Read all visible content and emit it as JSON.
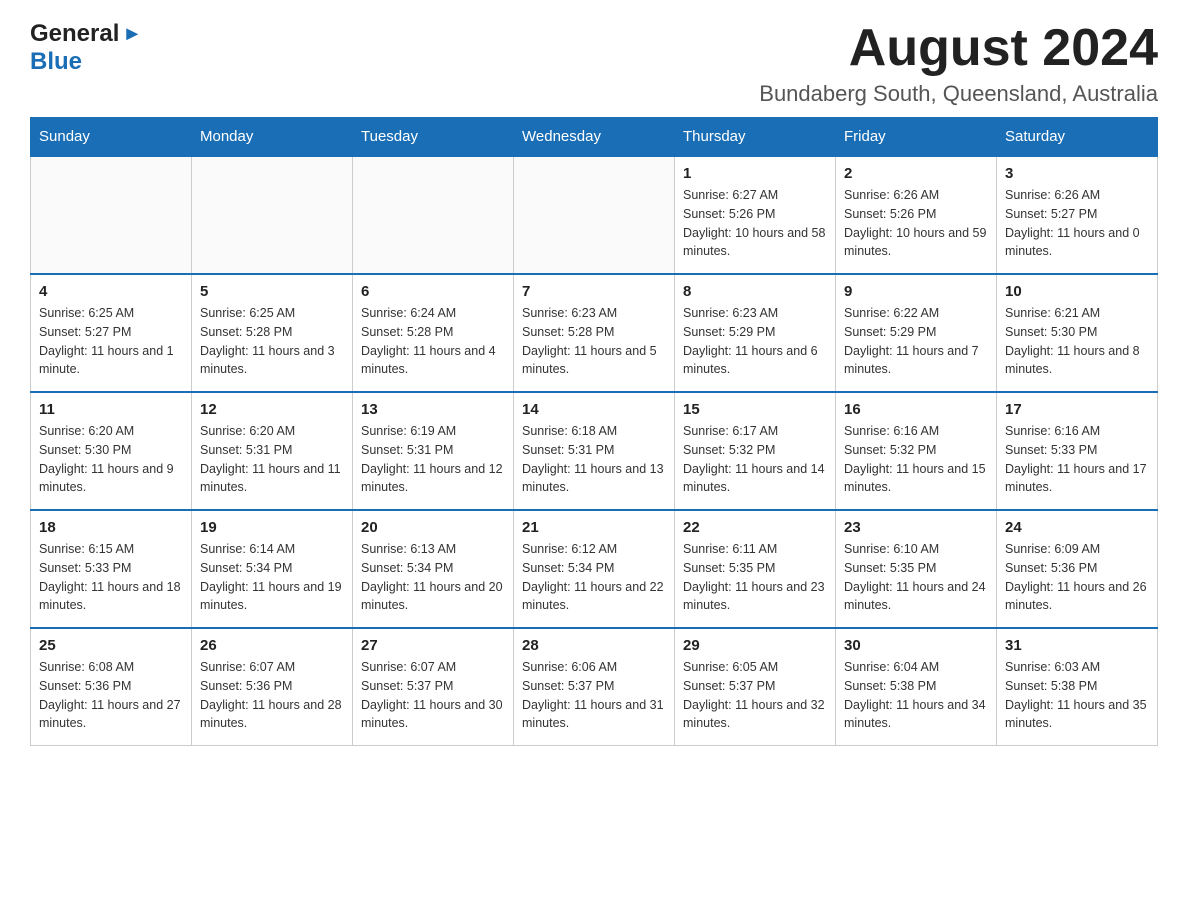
{
  "header": {
    "logo_general": "General",
    "logo_arrow": "▶",
    "logo_blue": "Blue",
    "month_title": "August 2024",
    "location": "Bundaberg South, Queensland, Australia"
  },
  "weekdays": [
    "Sunday",
    "Monday",
    "Tuesday",
    "Wednesday",
    "Thursday",
    "Friday",
    "Saturday"
  ],
  "weeks": [
    [
      {
        "day": "",
        "sunrise": "",
        "sunset": "",
        "daylight": ""
      },
      {
        "day": "",
        "sunrise": "",
        "sunset": "",
        "daylight": ""
      },
      {
        "day": "",
        "sunrise": "",
        "sunset": "",
        "daylight": ""
      },
      {
        "day": "",
        "sunrise": "",
        "sunset": "",
        "daylight": ""
      },
      {
        "day": "1",
        "sunrise": "Sunrise: 6:27 AM",
        "sunset": "Sunset: 5:26 PM",
        "daylight": "Daylight: 10 hours and 58 minutes."
      },
      {
        "day": "2",
        "sunrise": "Sunrise: 6:26 AM",
        "sunset": "Sunset: 5:26 PM",
        "daylight": "Daylight: 10 hours and 59 minutes."
      },
      {
        "day": "3",
        "sunrise": "Sunrise: 6:26 AM",
        "sunset": "Sunset: 5:27 PM",
        "daylight": "Daylight: 11 hours and 0 minutes."
      }
    ],
    [
      {
        "day": "4",
        "sunrise": "Sunrise: 6:25 AM",
        "sunset": "Sunset: 5:27 PM",
        "daylight": "Daylight: 11 hours and 1 minute."
      },
      {
        "day": "5",
        "sunrise": "Sunrise: 6:25 AM",
        "sunset": "Sunset: 5:28 PM",
        "daylight": "Daylight: 11 hours and 3 minutes."
      },
      {
        "day": "6",
        "sunrise": "Sunrise: 6:24 AM",
        "sunset": "Sunset: 5:28 PM",
        "daylight": "Daylight: 11 hours and 4 minutes."
      },
      {
        "day": "7",
        "sunrise": "Sunrise: 6:23 AM",
        "sunset": "Sunset: 5:28 PM",
        "daylight": "Daylight: 11 hours and 5 minutes."
      },
      {
        "day": "8",
        "sunrise": "Sunrise: 6:23 AM",
        "sunset": "Sunset: 5:29 PM",
        "daylight": "Daylight: 11 hours and 6 minutes."
      },
      {
        "day": "9",
        "sunrise": "Sunrise: 6:22 AM",
        "sunset": "Sunset: 5:29 PM",
        "daylight": "Daylight: 11 hours and 7 minutes."
      },
      {
        "day": "10",
        "sunrise": "Sunrise: 6:21 AM",
        "sunset": "Sunset: 5:30 PM",
        "daylight": "Daylight: 11 hours and 8 minutes."
      }
    ],
    [
      {
        "day": "11",
        "sunrise": "Sunrise: 6:20 AM",
        "sunset": "Sunset: 5:30 PM",
        "daylight": "Daylight: 11 hours and 9 minutes."
      },
      {
        "day": "12",
        "sunrise": "Sunrise: 6:20 AM",
        "sunset": "Sunset: 5:31 PM",
        "daylight": "Daylight: 11 hours and 11 minutes."
      },
      {
        "day": "13",
        "sunrise": "Sunrise: 6:19 AM",
        "sunset": "Sunset: 5:31 PM",
        "daylight": "Daylight: 11 hours and 12 minutes."
      },
      {
        "day": "14",
        "sunrise": "Sunrise: 6:18 AM",
        "sunset": "Sunset: 5:31 PM",
        "daylight": "Daylight: 11 hours and 13 minutes."
      },
      {
        "day": "15",
        "sunrise": "Sunrise: 6:17 AM",
        "sunset": "Sunset: 5:32 PM",
        "daylight": "Daylight: 11 hours and 14 minutes."
      },
      {
        "day": "16",
        "sunrise": "Sunrise: 6:16 AM",
        "sunset": "Sunset: 5:32 PM",
        "daylight": "Daylight: 11 hours and 15 minutes."
      },
      {
        "day": "17",
        "sunrise": "Sunrise: 6:16 AM",
        "sunset": "Sunset: 5:33 PM",
        "daylight": "Daylight: 11 hours and 17 minutes."
      }
    ],
    [
      {
        "day": "18",
        "sunrise": "Sunrise: 6:15 AM",
        "sunset": "Sunset: 5:33 PM",
        "daylight": "Daylight: 11 hours and 18 minutes."
      },
      {
        "day": "19",
        "sunrise": "Sunrise: 6:14 AM",
        "sunset": "Sunset: 5:34 PM",
        "daylight": "Daylight: 11 hours and 19 minutes."
      },
      {
        "day": "20",
        "sunrise": "Sunrise: 6:13 AM",
        "sunset": "Sunset: 5:34 PM",
        "daylight": "Daylight: 11 hours and 20 minutes."
      },
      {
        "day": "21",
        "sunrise": "Sunrise: 6:12 AM",
        "sunset": "Sunset: 5:34 PM",
        "daylight": "Daylight: 11 hours and 22 minutes."
      },
      {
        "day": "22",
        "sunrise": "Sunrise: 6:11 AM",
        "sunset": "Sunset: 5:35 PM",
        "daylight": "Daylight: 11 hours and 23 minutes."
      },
      {
        "day": "23",
        "sunrise": "Sunrise: 6:10 AM",
        "sunset": "Sunset: 5:35 PM",
        "daylight": "Daylight: 11 hours and 24 minutes."
      },
      {
        "day": "24",
        "sunrise": "Sunrise: 6:09 AM",
        "sunset": "Sunset: 5:36 PM",
        "daylight": "Daylight: 11 hours and 26 minutes."
      }
    ],
    [
      {
        "day": "25",
        "sunrise": "Sunrise: 6:08 AM",
        "sunset": "Sunset: 5:36 PM",
        "daylight": "Daylight: 11 hours and 27 minutes."
      },
      {
        "day": "26",
        "sunrise": "Sunrise: 6:07 AM",
        "sunset": "Sunset: 5:36 PM",
        "daylight": "Daylight: 11 hours and 28 minutes."
      },
      {
        "day": "27",
        "sunrise": "Sunrise: 6:07 AM",
        "sunset": "Sunset: 5:37 PM",
        "daylight": "Daylight: 11 hours and 30 minutes."
      },
      {
        "day": "28",
        "sunrise": "Sunrise: 6:06 AM",
        "sunset": "Sunset: 5:37 PM",
        "daylight": "Daylight: 11 hours and 31 minutes."
      },
      {
        "day": "29",
        "sunrise": "Sunrise: 6:05 AM",
        "sunset": "Sunset: 5:37 PM",
        "daylight": "Daylight: 11 hours and 32 minutes."
      },
      {
        "day": "30",
        "sunrise": "Sunrise: 6:04 AM",
        "sunset": "Sunset: 5:38 PM",
        "daylight": "Daylight: 11 hours and 34 minutes."
      },
      {
        "day": "31",
        "sunrise": "Sunrise: 6:03 AM",
        "sunset": "Sunset: 5:38 PM",
        "daylight": "Daylight: 11 hours and 35 minutes."
      }
    ]
  ]
}
